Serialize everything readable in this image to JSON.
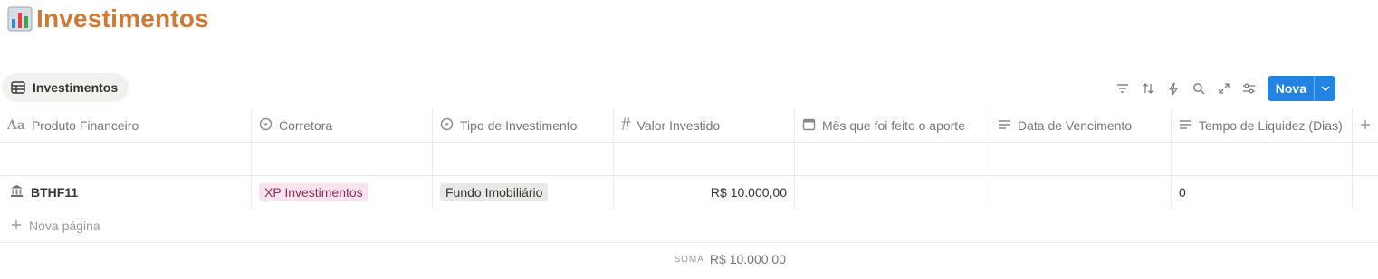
{
  "page": {
    "title": "Investimentos",
    "icon": "bar-chart-icon"
  },
  "view": {
    "tab_label": "Investimentos",
    "tab_icon": "table-icon"
  },
  "toolbar": {
    "icons": [
      "filter-icon",
      "sort-icon",
      "automation-icon",
      "search-icon",
      "expand-icon",
      "settings-icon"
    ],
    "new_label": "Nova",
    "accent": "#2383e2"
  },
  "columns": [
    {
      "label": "Produto Financeiro",
      "icon": "text-type-icon"
    },
    {
      "label": "Corretora",
      "icon": "select-icon"
    },
    {
      "label": "Tipo de Investimento",
      "icon": "select-icon"
    },
    {
      "label": "Valor Investido",
      "icon": "number-icon"
    },
    {
      "label": "Mês que foi feito o aporte",
      "icon": "calendar-icon"
    },
    {
      "label": "Data de Vencimento",
      "icon": "text-lines-icon"
    },
    {
      "label": "Tempo de Liquidez (Dias)",
      "icon": "text-lines-icon"
    }
  ],
  "rows": [
    {
      "produto": "BTHF11",
      "produto_icon": "bank-icon",
      "corretora": "XP Investimentos",
      "tipo": "Fundo Imobiliário",
      "valor": "R$ 10.000,00",
      "mes": "",
      "vencimento": "",
      "liquidez": "0"
    }
  ],
  "new_page_label": "Nova página",
  "summary": {
    "label": "SOMA",
    "value": "R$ 10.000,00"
  },
  "colors": {
    "title": "#cb7b37",
    "tag_pink_bg": "#f9e4ef",
    "tag_gray_bg": "#e8e8e6"
  }
}
